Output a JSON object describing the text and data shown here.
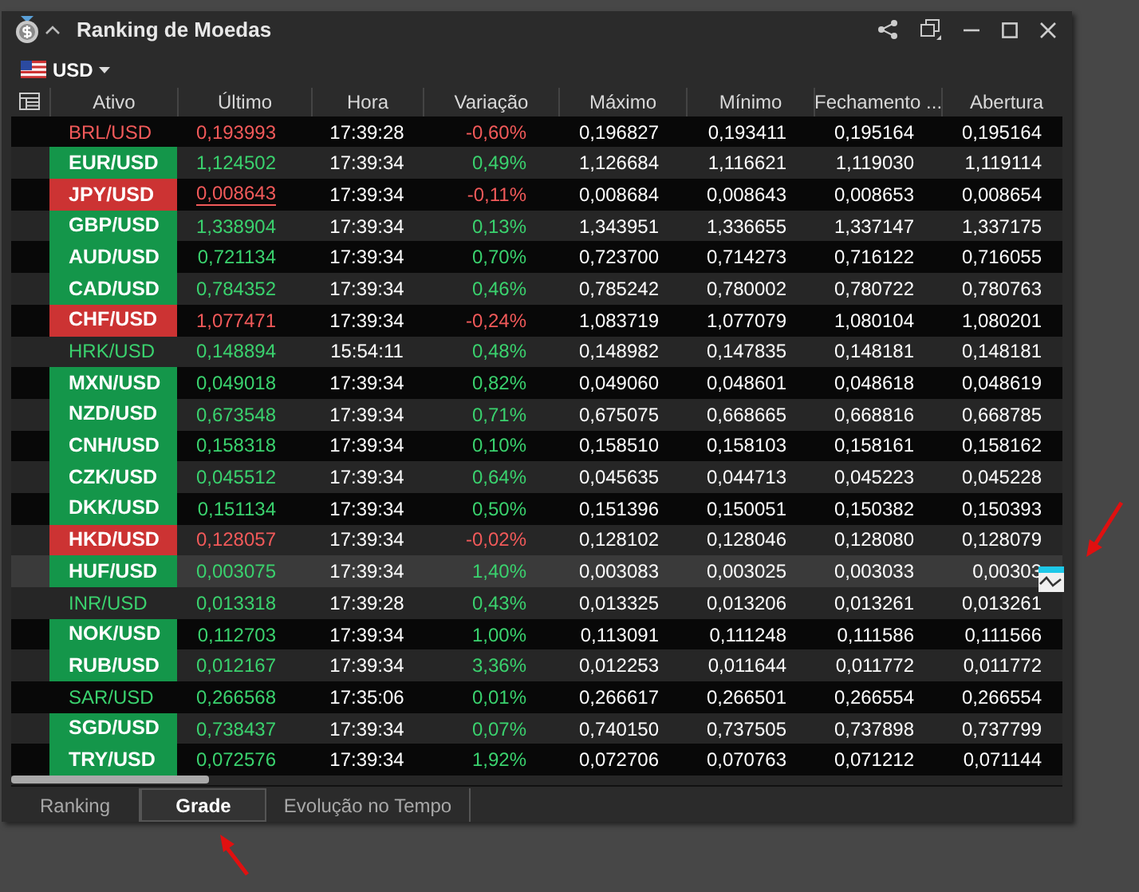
{
  "window": {
    "title": "Ranking de Moedas"
  },
  "currency": {
    "label": "USD"
  },
  "table": {
    "columns": [
      "Ativo",
      "Último",
      "Hora",
      "Variação",
      "Máximo",
      "Mínimo",
      "Fechamento ...",
      "Abertura"
    ],
    "rows": [
      {
        "cells": [
          "BRL/USD",
          "0,193993",
          "17:39:28",
          "-0,60%",
          "0,196827",
          "0,193411",
          "0,195164",
          "0,195164"
        ],
        "up": false,
        "highlighted": false,
        "selected": false,
        "underline": false
      },
      {
        "cells": [
          "EUR/USD",
          "1,124502",
          "17:39:34",
          "0,49%",
          "1,126684",
          "1,116621",
          "1,119030",
          "1,119114"
        ],
        "up": true,
        "highlighted": true,
        "selected": false,
        "underline": false
      },
      {
        "cells": [
          "JPY/USD",
          "0,008643",
          "17:39:34",
          "-0,11%",
          "0,008684",
          "0,008643",
          "0,008653",
          "0,008654"
        ],
        "up": false,
        "highlighted": true,
        "selected": false,
        "underline": true
      },
      {
        "cells": [
          "GBP/USD",
          "1,338904",
          "17:39:34",
          "0,13%",
          "1,343951",
          "1,336655",
          "1,337147",
          "1,337175"
        ],
        "up": true,
        "highlighted": true,
        "selected": false,
        "underline": false
      },
      {
        "cells": [
          "AUD/USD",
          "0,721134",
          "17:39:34",
          "0,70%",
          "0,723700",
          "0,714273",
          "0,716122",
          "0,716055"
        ],
        "up": true,
        "highlighted": true,
        "selected": false,
        "underline": false
      },
      {
        "cells": [
          "CAD/USD",
          "0,784352",
          "17:39:34",
          "0,46%",
          "0,785242",
          "0,780002",
          "0,780722",
          "0,780763"
        ],
        "up": true,
        "highlighted": true,
        "selected": false,
        "underline": false
      },
      {
        "cells": [
          "CHF/USD",
          "1,077471",
          "17:39:34",
          "-0,24%",
          "1,083719",
          "1,077079",
          "1,080104",
          "1,080201"
        ],
        "up": false,
        "highlighted": true,
        "selected": false,
        "underline": false
      },
      {
        "cells": [
          "HRK/USD",
          "0,148894",
          "15:54:11",
          "0,48%",
          "0,148982",
          "0,147835",
          "0,148181",
          "0,148181"
        ],
        "up": true,
        "highlighted": false,
        "selected": false,
        "underline": false
      },
      {
        "cells": [
          "MXN/USD",
          "0,049018",
          "17:39:34",
          "0,82%",
          "0,049060",
          "0,048601",
          "0,048618",
          "0,048619"
        ],
        "up": true,
        "highlighted": true,
        "selected": false,
        "underline": false
      },
      {
        "cells": [
          "NZD/USD",
          "0,673548",
          "17:39:34",
          "0,71%",
          "0,675075",
          "0,668665",
          "0,668816",
          "0,668785"
        ],
        "up": true,
        "highlighted": true,
        "selected": false,
        "underline": false
      },
      {
        "cells": [
          "CNH/USD",
          "0,158318",
          "17:39:34",
          "0,10%",
          "0,158510",
          "0,158103",
          "0,158161",
          "0,158162"
        ],
        "up": true,
        "highlighted": true,
        "selected": false,
        "underline": false
      },
      {
        "cells": [
          "CZK/USD",
          "0,045512",
          "17:39:34",
          "0,64%",
          "0,045635",
          "0,044713",
          "0,045223",
          "0,045228"
        ],
        "up": true,
        "highlighted": true,
        "selected": false,
        "underline": false
      },
      {
        "cells": [
          "DKK/USD",
          "0,151134",
          "17:39:34",
          "0,50%",
          "0,151396",
          "0,150051",
          "0,150382",
          "0,150393"
        ],
        "up": true,
        "highlighted": true,
        "selected": false,
        "underline": false
      },
      {
        "cells": [
          "HKD/USD",
          "0,128057",
          "17:39:34",
          "-0,02%",
          "0,128102",
          "0,128046",
          "0,128080",
          "0,128079"
        ],
        "up": false,
        "highlighted": true,
        "selected": false,
        "underline": false
      },
      {
        "cells": [
          "HUF/USD",
          "0,003075",
          "17:39:34",
          "1,40%",
          "0,003083",
          "0,003025",
          "0,003033",
          "0,00303"
        ],
        "up": true,
        "highlighted": true,
        "selected": true,
        "underline": false
      },
      {
        "cells": [
          "INR/USD",
          "0,013318",
          "17:39:28",
          "0,43%",
          "0,013325",
          "0,013206",
          "0,013261",
          "0,013261"
        ],
        "up": true,
        "highlighted": false,
        "selected": false,
        "underline": false
      },
      {
        "cells": [
          "NOK/USD",
          "0,112703",
          "17:39:34",
          "1,00%",
          "0,113091",
          "0,111248",
          "0,111586",
          "0,111566"
        ],
        "up": true,
        "highlighted": true,
        "selected": false,
        "underline": false
      },
      {
        "cells": [
          "RUB/USD",
          "0,012167",
          "17:39:34",
          "3,36%",
          "0,012253",
          "0,011644",
          "0,011772",
          "0,011772"
        ],
        "up": true,
        "highlighted": true,
        "selected": false,
        "underline": false
      },
      {
        "cells": [
          "SAR/USD",
          "0,266568",
          "17:35:06",
          "0,01%",
          "0,266617",
          "0,266501",
          "0,266554",
          "0,266554"
        ],
        "up": true,
        "highlighted": false,
        "selected": false,
        "underline": false
      },
      {
        "cells": [
          "SGD/USD",
          "0,738437",
          "17:39:34",
          "0,07%",
          "0,740150",
          "0,737505",
          "0,737898",
          "0,737799"
        ],
        "up": true,
        "highlighted": true,
        "selected": false,
        "underline": false
      },
      {
        "cells": [
          "TRY/USD",
          "0,072576",
          "17:39:34",
          "1,92%",
          "0,072706",
          "0,070763",
          "0,071212",
          "0,071144"
        ],
        "up": true,
        "highlighted": true,
        "selected": false,
        "underline": false
      }
    ]
  },
  "tabs": [
    {
      "label": "Ranking",
      "selected": false
    },
    {
      "label": "Grade",
      "selected": true
    },
    {
      "label": "Evolução no Tempo",
      "selected": false
    }
  ]
}
